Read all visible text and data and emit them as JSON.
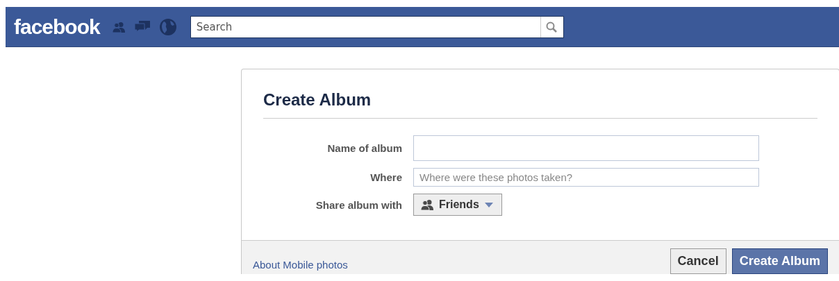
{
  "topbar": {
    "logo": "facebook",
    "search": {
      "placeholder": "Search"
    }
  },
  "dialog": {
    "title": "Create Album",
    "fields": [
      {
        "kind": "text",
        "label": "Name of album"
      },
      {
        "kind": "text",
        "label": "Where",
        "placeholder": "Where were these photos taken?"
      },
      {
        "kind": "select",
        "label": "Share album with",
        "value": "Friends"
      }
    ],
    "footer": {
      "link": "About Mobile photos",
      "buttons": [
        {
          "label": "Cancel",
          "primary": false
        },
        {
          "label": "Create Album",
          "primary": true
        }
      ]
    }
  }
}
